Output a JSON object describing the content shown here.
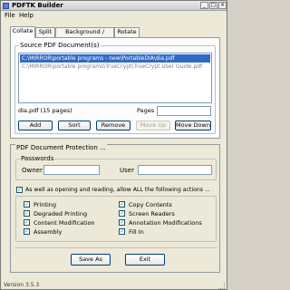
{
  "window": {
    "title": "PDFTK Builder",
    "minimize_glyph": "_",
    "maximize_glyph": "□",
    "close_glyph": "×"
  },
  "menu": [
    {
      "label": "File"
    },
    {
      "label": "Help"
    }
  ],
  "tabs": [
    {
      "label": "Collate",
      "active": true
    },
    {
      "label": "Split"
    },
    {
      "label": "Background / Stamp"
    },
    {
      "label": "Rotate"
    }
  ],
  "collate": {
    "source_legend": "Source PDF Document(s)",
    "files": [
      {
        "path": "C:\\MIRROR\\portable programs - new\\PortableDIA\\dia.pdf",
        "selected": true
      },
      {
        "path": "C:\\MIRROR\\portable programs\\TrueCrypt\\TrueCrypt User Guide.pdf",
        "selected": false
      }
    ],
    "file_info": "dia.pdf  (15 pages)",
    "pages_label": "Pages",
    "pages_value": "",
    "buttons": {
      "add": "Add",
      "sort": "Sort",
      "remove": "Remove",
      "move_up": "Move Up",
      "move_down": "Move Down"
    }
  },
  "protection": {
    "legend": "PDF Document Protection ...",
    "passwords_legend": "Passwords",
    "owner_label": "Owner",
    "owner_value": "",
    "user_label": "User",
    "user_value": "",
    "allow_all_label": "As well as opening and reading, allow ALL the following actions ...",
    "allow_all_checked": true,
    "permissions": [
      {
        "label": "Printing",
        "checked": true
      },
      {
        "label": "Copy Contents",
        "checked": true
      },
      {
        "label": "Degraded Printing",
        "checked": true
      },
      {
        "label": "Screen Readers",
        "checked": true
      },
      {
        "label": "Content Modification",
        "checked": true
      },
      {
        "label": "Annotation Modifications",
        "checked": true
      },
      {
        "label": "Assembly",
        "checked": true
      },
      {
        "label": "Fill In",
        "checked": true
      }
    ],
    "check_glyph": "✓"
  },
  "footer": {
    "save_as": "Save As",
    "exit": "Exit"
  },
  "status": {
    "version": "Version 3.5.3"
  },
  "colors": {
    "selection": "#316ac5",
    "check": "#21a121",
    "face": "#ece9d8"
  }
}
